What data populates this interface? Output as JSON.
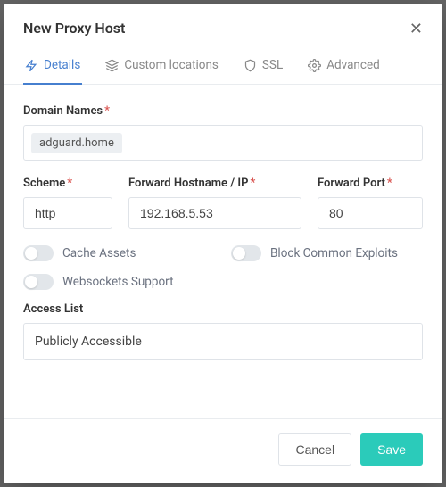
{
  "modal": {
    "title": "New Proxy Host"
  },
  "tabs": {
    "details": "Details",
    "custom": "Custom locations",
    "ssl": "SSL",
    "advanced": "Advanced"
  },
  "labels": {
    "domain_names": "Domain Names",
    "scheme": "Scheme",
    "forward_host": "Forward Hostname / IP",
    "forward_port": "Forward Port",
    "cache_assets": "Cache Assets",
    "block_exploits": "Block Common Exploits",
    "websockets": "Websockets Support",
    "access_list": "Access List"
  },
  "values": {
    "domain_tag": "adguard.home",
    "scheme": "http",
    "forward_host": "192.168.5.53",
    "forward_port": "80",
    "access_list": "Publicly Accessible"
  },
  "toggles": {
    "cache_assets": false,
    "block_exploits": false,
    "websockets": false
  },
  "footer": {
    "cancel": "Cancel",
    "save": "Save"
  },
  "required_marker": "*"
}
